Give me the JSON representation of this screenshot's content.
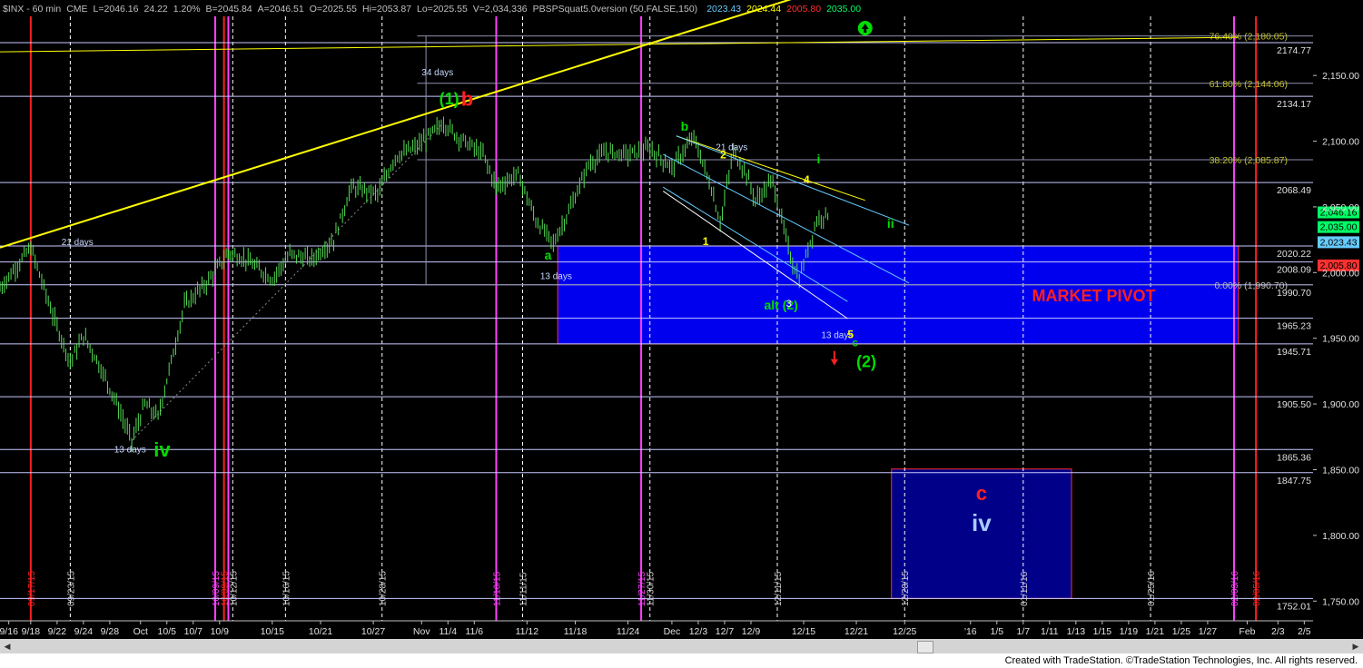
{
  "header": {
    "symbol": "$INX - 60 min",
    "exchange": "CME",
    "last": "L=2046.16",
    "change": "24.22",
    "change_pct": "1.20%",
    "bid": "B=2045.84",
    "ask": "A=2046.51",
    "open": "O=2025.55",
    "high": "Hi=2053.87",
    "low": "Lo=2025.55",
    "volume": "V=2,034,336",
    "indicator": "PBSPSquat5.0version (50,FALSE,150)",
    "ind_values": [
      "2023.43",
      "2024.44",
      "2005.80",
      "2035.00"
    ],
    "ind_colors": [
      "#66ccff",
      "#ffff00",
      "#ff3030",
      "#00ff66"
    ]
  },
  "footer": {
    "credit": "Created with TradeStation. ©TradeStation Technologies, Inc. All rights reserved."
  },
  "scrollbar": {
    "left_arrow": "◀",
    "right_arrow": "▶"
  },
  "chart_data": {
    "type": "candlestick",
    "ylim": [
      1735,
      2195
    ],
    "y_ticks": [
      1750,
      1800,
      1850,
      1900,
      1950,
      2000,
      2050,
      2100,
      2150
    ],
    "y_tick_labels": [
      "1,750.00",
      "1,800.00",
      "1,850.00",
      "1,900.00",
      "1,950.00",
      "2,000.00",
      "2,050.00",
      "2,100.00",
      "2,150.00"
    ],
    "x_ticks": [
      {
        "label": "9/16",
        "i": 2
      },
      {
        "label": "9/18",
        "i": 7
      },
      {
        "label": "9/22",
        "i": 13
      },
      {
        "label": "9/24",
        "i": 19
      },
      {
        "label": "9/28",
        "i": 25
      },
      {
        "label": "Oct",
        "i": 32
      },
      {
        "label": "10/5",
        "i": 38
      },
      {
        "label": "10/7",
        "i": 44
      },
      {
        "label": "10/9",
        "i": 50
      },
      {
        "label": "10/15",
        "i": 62
      },
      {
        "label": "10/21",
        "i": 73
      },
      {
        "label": "10/27",
        "i": 85
      },
      {
        "label": "Nov",
        "i": 96
      },
      {
        "label": "11/4",
        "i": 102
      },
      {
        "label": "11/6",
        "i": 108
      },
      {
        "label": "11/12",
        "i": 120
      },
      {
        "label": "11/18",
        "i": 131
      },
      {
        "label": "11/24",
        "i": 143
      },
      {
        "label": "Dec",
        "i": 153
      },
      {
        "label": "12/3",
        "i": 159
      },
      {
        "label": "12/7",
        "i": 165
      },
      {
        "label": "12/9",
        "i": 171
      },
      {
        "label": "12/15",
        "i": 183
      },
      {
        "label": "12/21",
        "i": 195
      },
      {
        "label": "12/25",
        "i": 206
      },
      {
        "label": "'16",
        "i": 221
      },
      {
        "label": "1/5",
        "i": 227
      },
      {
        "label": "1/7",
        "i": 233
      },
      {
        "label": "1/11",
        "i": 239
      },
      {
        "label": "1/13",
        "i": 245
      },
      {
        "label": "1/15",
        "i": 251
      },
      {
        "label": "1/19",
        "i": 257
      },
      {
        "label": "1/21",
        "i": 263
      },
      {
        "label": "1/25",
        "i": 269
      },
      {
        "label": "1/27",
        "i": 275
      },
      {
        "label": "Feb",
        "i": 284
      },
      {
        "label": "2/3",
        "i": 291
      },
      {
        "label": "2/5",
        "i": 297
      }
    ],
    "price_pivots": [
      [
        0,
        1988
      ],
      [
        7,
        2019
      ],
      [
        12,
        1968
      ],
      [
        16,
        1932
      ],
      [
        19,
        1952
      ],
      [
        22,
        1934
      ],
      [
        26,
        1905
      ],
      [
        30,
        1872
      ],
      [
        33,
        1900
      ],
      [
        36,
        1890
      ],
      [
        42,
        1975
      ],
      [
        47,
        1992
      ],
      [
        52,
        2015
      ],
      [
        56,
        2010
      ],
      [
        62,
        1995
      ],
      [
        66,
        2014
      ],
      [
        71,
        2010
      ],
      [
        76,
        2025
      ],
      [
        80,
        2065
      ],
      [
        86,
        2060
      ],
      [
        90,
        2088
      ],
      [
        95,
        2096
      ],
      [
        101,
        2114
      ],
      [
        104,
        2104
      ],
      [
        110,
        2090
      ],
      [
        113,
        2065
      ],
      [
        118,
        2075
      ],
      [
        122,
        2040
      ],
      [
        126,
        2022
      ],
      [
        130,
        2050
      ],
      [
        134,
        2082
      ],
      [
        138,
        2092
      ],
      [
        143,
        2090
      ],
      [
        148,
        2094
      ],
      [
        153,
        2080
      ],
      [
        158,
        2103
      ],
      [
        162,
        2064
      ],
      [
        164,
        2038
      ],
      [
        167,
        2092
      ],
      [
        170,
        2075
      ],
      [
        172,
        2055
      ],
      [
        176,
        2070
      ],
      [
        178,
        2040
      ],
      [
        180,
        2012
      ],
      [
        182,
        1995
      ],
      [
        184,
        2018
      ],
      [
        186,
        2040
      ],
      [
        189,
        2046
      ]
    ],
    "hlines": [
      {
        "value": 2175,
        "label": "2174.77"
      },
      {
        "value": 2134.17,
        "label": "2134.17"
      },
      {
        "value": 2068.49,
        "label": "2068.49"
      },
      {
        "value": 2020.22,
        "label": "2020.22"
      },
      {
        "value": 2008.09,
        "label": "2008.09"
      },
      {
        "value": 1990.7,
        "label": "1990.70"
      },
      {
        "value": 1965.23,
        "label": "1965.23"
      },
      {
        "value": 1945.71,
        "label": "1945.71"
      },
      {
        "value": 1905.5,
        "label": "1905.50"
      },
      {
        "value": 1865.36,
        "label": "1865.36"
      },
      {
        "value": 1847.75,
        "label": "1847.75"
      },
      {
        "value": 1752.01,
        "label": "1752.01"
      }
    ],
    "fib_levels": [
      {
        "value": 2180.05,
        "label": "76.40% (2,180.05)",
        "label_value": 2180.05
      },
      {
        "value": 2144.06,
        "label": "61.80% (2,144.06)",
        "label_value": 2144.06
      },
      {
        "value": 2085.87,
        "label": "38.20% (2,085.87)",
        "label_value": 2085.87
      },
      {
        "value": 1990.7,
        "label": "0.00% (1,990.70)",
        "label_value": 1990.7
      }
    ],
    "right_boxes": [
      {
        "value": 2046.16,
        "label": "2,046.16",
        "bg": "#00ff66",
        "fg": "#000000"
      },
      {
        "value": 2035.0,
        "label": "2,035.00",
        "bg": "#00ff66",
        "fg": "#000000"
      },
      {
        "value": 2023.43,
        "label": "2,023.43",
        "bg": "#66ccff",
        "fg": "#000000"
      },
      {
        "value": 2005.8,
        "label": "2,005.80",
        "bg": "#ff3030",
        "fg": "#000000"
      }
    ],
    "vlines": [
      {
        "i": 7,
        "color": "#ff2020",
        "date": "09/17/15"
      },
      {
        "i": 16,
        "color": "#ffffff",
        "date": "09/23/15",
        "dashed": true
      },
      {
        "i": 49,
        "color": "#ff40ff",
        "date": "10/09/15"
      },
      {
        "i": 51,
        "color": "#ff2020",
        "date": "10/09/15"
      },
      {
        "i": 52,
        "color": "#ff40ff",
        "date": ""
      },
      {
        "i": 53,
        "color": "#ffffff",
        "date": "10/12/15",
        "dashed": true
      },
      {
        "i": 65,
        "color": "#ffffff",
        "date": "10/16/15",
        "dashed": true
      },
      {
        "i": 87,
        "color": "#ffffff",
        "date": "10/28/15",
        "dashed": true
      },
      {
        "i": 113,
        "color": "#ff40ff",
        "date": "11/10/15"
      },
      {
        "i": 119,
        "color": "#ffffff",
        "date": "11/11/15",
        "dashed": true
      },
      {
        "i": 146,
        "color": "#ff40ff",
        "date": "11/27/15"
      },
      {
        "i": 148,
        "color": "#ffffff",
        "date": "11/30/15",
        "dashed": true
      },
      {
        "i": 177,
        "color": "#ffffff",
        "date": "12/11/15",
        "dashed": true
      },
      {
        "i": 206,
        "color": "#ffffff",
        "date": "12/28/15",
        "dashed": true
      },
      {
        "i": 233,
        "color": "#ffffff",
        "date": "01/11/16",
        "dashed": true
      },
      {
        "i": 262,
        "color": "#ffffff",
        "date": "01/25/16",
        "dashed": true
      },
      {
        "i": 281,
        "color": "#ff40ff",
        "date": "02/03/16"
      },
      {
        "i": 286,
        "color": "#ff2020",
        "date": "02/05/16"
      }
    ],
    "pivot_zone": {
      "label": "MARKET PIVOT",
      "i_from": 127,
      "i_to": 282,
      "low": 1945.71,
      "high": 2020.22
    },
    "target_zone": {
      "i_from": 203,
      "i_to": 244,
      "low": 1752.01,
      "high": 1850.5,
      "label1": "c",
      "label2": "iv"
    },
    "trendlines": [
      {
        "from": [
          0,
          2019
        ],
        "to": [
          182,
          2210
        ],
        "color": "#ffff00",
        "width": 2
      },
      {
        "from": [
          0,
          2168
        ],
        "to": [
          282,
          2179
        ],
        "color": "#ffff00",
        "width": 1
      },
      {
        "from": [
          154,
          2104
        ],
        "to": [
          197,
          2055
        ],
        "color": "#ffff00",
        "width": 1
      },
      {
        "from": [
          151,
          2090
        ],
        "to": [
          207,
          1992
        ],
        "color": "#66ccff",
        "width": 1
      },
      {
        "from": [
          151,
          2065
        ],
        "to": [
          193,
          1978
        ],
        "color": "#66ccff",
        "width": 1
      },
      {
        "from": [
          151,
          2062
        ],
        "to": [
          193,
          1965
        ],
        "color": "#ffffff",
        "width": 1
      },
      {
        "from": [
          154,
          2104
        ],
        "to": [
          207,
          2036
        ],
        "color": "#66ccff",
        "width": 1
      },
      {
        "from": [
          30,
          1872
        ],
        "to": [
          101,
          2114
        ],
        "color": "#888888",
        "width": 1,
        "dashed": true
      }
    ],
    "annotations": [
      {
        "text": "(1)",
        "i": 100,
        "v": 2128,
        "color": "#00dd00",
        "size": 18
      },
      {
        "text": "b",
        "i": 105,
        "v": 2127,
        "color": "#ff2020",
        "size": 22
      },
      {
        "text": "34 days",
        "i": 96,
        "v": 2150,
        "color": "#c8d8ff",
        "size": 10
      },
      {
        "text": "21 days",
        "i": 14,
        "v": 2021,
        "color": "#c8d8ff",
        "size": 10
      },
      {
        "text": "13 days",
        "i": 26,
        "v": 1863,
        "color": "#c8d8ff",
        "size": 10
      },
      {
        "text": "iv",
        "i": 35,
        "v": 1860,
        "color": "#00dd00",
        "size": 22
      },
      {
        "text": "a",
        "i": 124,
        "v": 2010,
        "color": "#00dd00",
        "size": 14
      },
      {
        "text": "13 days",
        "i": 123,
        "v": 1995,
        "color": "#c8d8ff",
        "size": 10
      },
      {
        "text": "b",
        "i": 155,
        "v": 2108,
        "color": "#00dd00",
        "size": 14
      },
      {
        "text": "21 days",
        "i": 163,
        "v": 2093,
        "color": "#c8d8ff",
        "size": 10
      },
      {
        "text": "2",
        "i": 164,
        "v": 2087,
        "color": "#ffff00",
        "size": 12
      },
      {
        "text": "1",
        "i": 160,
        "v": 2021,
        "color": "#ffff00",
        "size": 12
      },
      {
        "text": "i",
        "i": 186,
        "v": 2083,
        "color": "#00dd00",
        "size": 14
      },
      {
        "text": "4",
        "i": 183,
        "v": 2068,
        "color": "#ffff00",
        "size": 12
      },
      {
        "text": "ii",
        "i": 202,
        "v": 2034,
        "color": "#00dd00",
        "size": 14
      },
      {
        "text": "alt (2)",
        "i": 174,
        "v": 1972,
        "color": "#00dd00",
        "size": 14
      },
      {
        "text": "3",
        "i": 179,
        "v": 1974,
        "color": "#ffffff",
        "size": 11
      },
      {
        "text": "13 days",
        "i": 187,
        "v": 1950,
        "color": "#c8d8ff",
        "size": 10
      },
      {
        "text": "5",
        "i": 193,
        "v": 1950,
        "color": "#ffff00",
        "size": 12
      },
      {
        "text": "c",
        "i": 194,
        "v": 1944,
        "color": "#00dd00",
        "size": 12
      },
      {
        "text": "(2)",
        "i": 195,
        "v": 1928,
        "color": "#00dd00",
        "size": 18
      },
      {
        "text": "MARKET PIVOT",
        "i": 235,
        "v": 1978,
        "color": "#ff2020",
        "size": 18
      }
    ],
    "arrows": [
      {
        "i": 190,
        "v": 1932,
        "dir": "down",
        "color": "#ff2020"
      },
      {
        "i": 197,
        "v": 2186,
        "dir": "up",
        "color": "#00dd00"
      }
    ],
    "grid": false
  }
}
